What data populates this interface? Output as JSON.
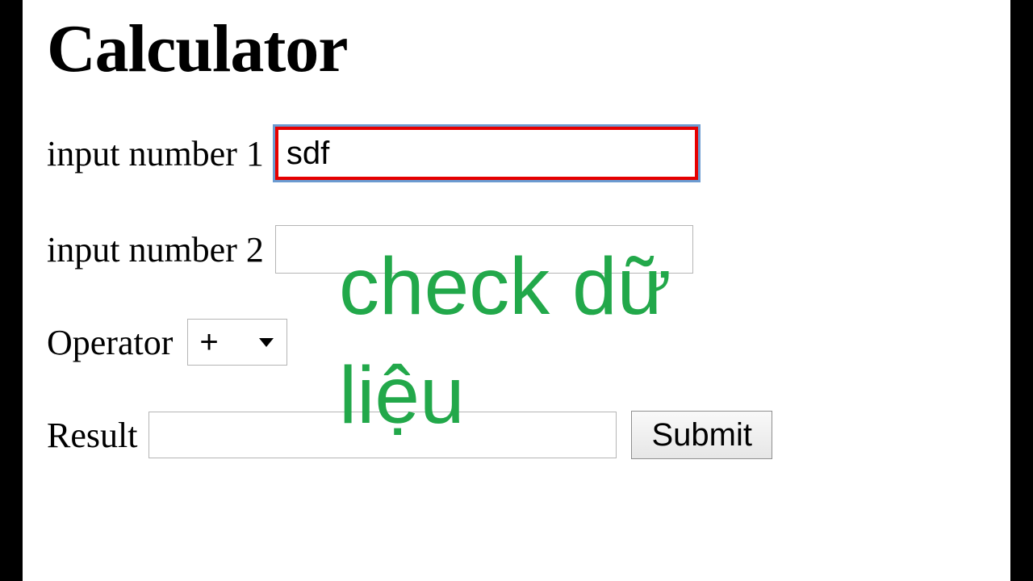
{
  "title": "Calculator",
  "labels": {
    "input1": "input number 1",
    "input2": "input number 2",
    "operator": "Operator",
    "result": "Result"
  },
  "values": {
    "input1": "sdf",
    "input2": "",
    "operator": "+",
    "result": ""
  },
  "buttons": {
    "submit": "Submit"
  },
  "overlay": "check dữ\nliệu"
}
